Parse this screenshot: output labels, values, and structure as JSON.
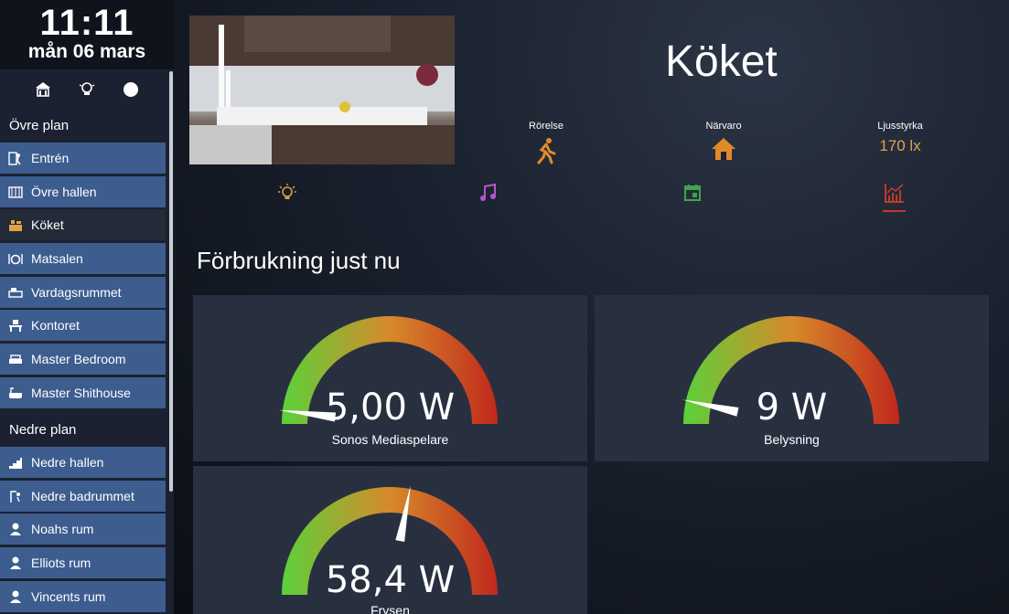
{
  "clock": {
    "time": "11:11",
    "date": "mån 06 mars"
  },
  "quick_icons": [
    "house-icon",
    "lightbulb-icon",
    "compass-icon"
  ],
  "sidebar": {
    "upper_title": "Övre plan",
    "upper_items": [
      {
        "label": "Entrén",
        "icon": "entrance-icon"
      },
      {
        "label": "Övre hallen",
        "icon": "hallway-icon"
      },
      {
        "label": "Köket",
        "icon": "kitchen-icon"
      },
      {
        "label": "Matsalen",
        "icon": "dining-icon"
      },
      {
        "label": "Vardagsrummet",
        "icon": "sofa-icon"
      },
      {
        "label": "Kontoret",
        "icon": "office-icon"
      },
      {
        "label": "Master Bedroom",
        "icon": "bed-icon"
      },
      {
        "label": "Master Shithouse",
        "icon": "bathtub-icon"
      }
    ],
    "lower_title": "Nedre plan",
    "lower_items": [
      {
        "label": "Nedre hallen",
        "icon": "stairs-icon"
      },
      {
        "label": "Nedre badrummet",
        "icon": "shower-icon"
      },
      {
        "label": "Noahs rum",
        "icon": "person-icon"
      },
      {
        "label": "Elliots rum",
        "icon": "person-icon"
      },
      {
        "label": "Vincents rum",
        "icon": "person-icon"
      }
    ]
  },
  "room": {
    "title": "Köket",
    "sensors": [
      {
        "label": "Rörelse",
        "icon": "running-person-icon"
      },
      {
        "label": "Närvaro",
        "icon": "home-icon"
      },
      {
        "label": "Ljusstyrka",
        "value": "170 lx"
      }
    ],
    "tabs": [
      "lightbulb-icon",
      "music-note-icon",
      "calendar-icon",
      "chart-icon"
    ]
  },
  "consumption": {
    "heading": "Förbrukning just nu",
    "gauges": [
      {
        "value_text": "5,00 W",
        "name": "Sonos Mediaspelare",
        "fraction": 0.04
      },
      {
        "value_text": "9 W",
        "name": "Belysning",
        "fraction": 0.07
      },
      {
        "value_text": "58,4 W",
        "name": "Frysen",
        "fraction": 0.56
      }
    ]
  },
  "colors": {
    "accent_orange": "#e2a24a",
    "nav_blue": "#3d5d8f",
    "gauge_low": "#5bd13a",
    "gauge_mid": "#d78a2a",
    "gauge_high": "#c0281c"
  }
}
